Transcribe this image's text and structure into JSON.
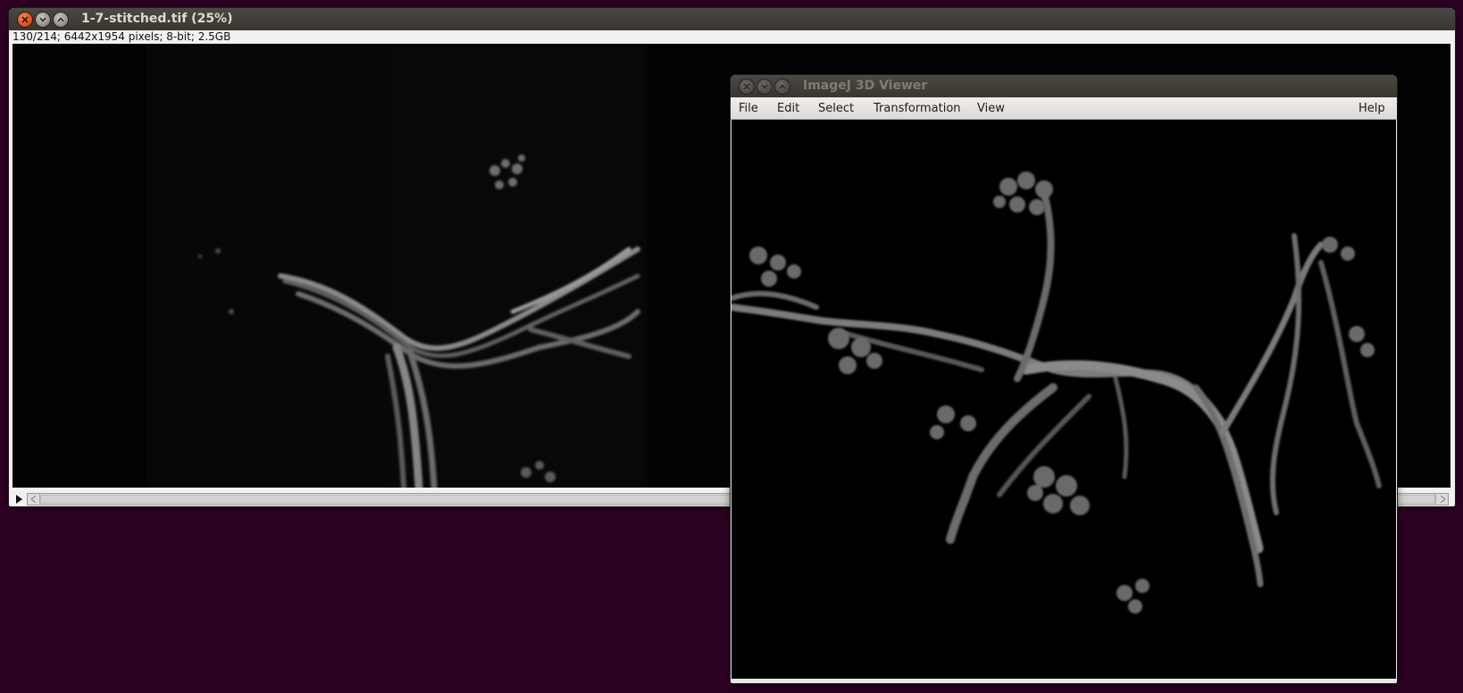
{
  "main_window": {
    "title": "1-7-stitched.tif (25%)",
    "info": "130/214; 6442x1954 pixels; 8-bit; 2.5GB"
  },
  "viewer_window": {
    "title": "ImageJ 3D Viewer",
    "menus": [
      "File",
      "Edit",
      "Select",
      "Transformation",
      "View",
      "Help"
    ]
  },
  "colors": {
    "desktop": "#2c0022",
    "close_button": "#dd4814",
    "titlebar": "#3c3b37"
  },
  "icons": {
    "close": "close-icon",
    "minimize": "minimize-icon",
    "maximize": "maximize-icon",
    "play": "play-icon",
    "scroll_left": "arrow-left-icon",
    "scroll_right": "arrow-right-icon"
  }
}
